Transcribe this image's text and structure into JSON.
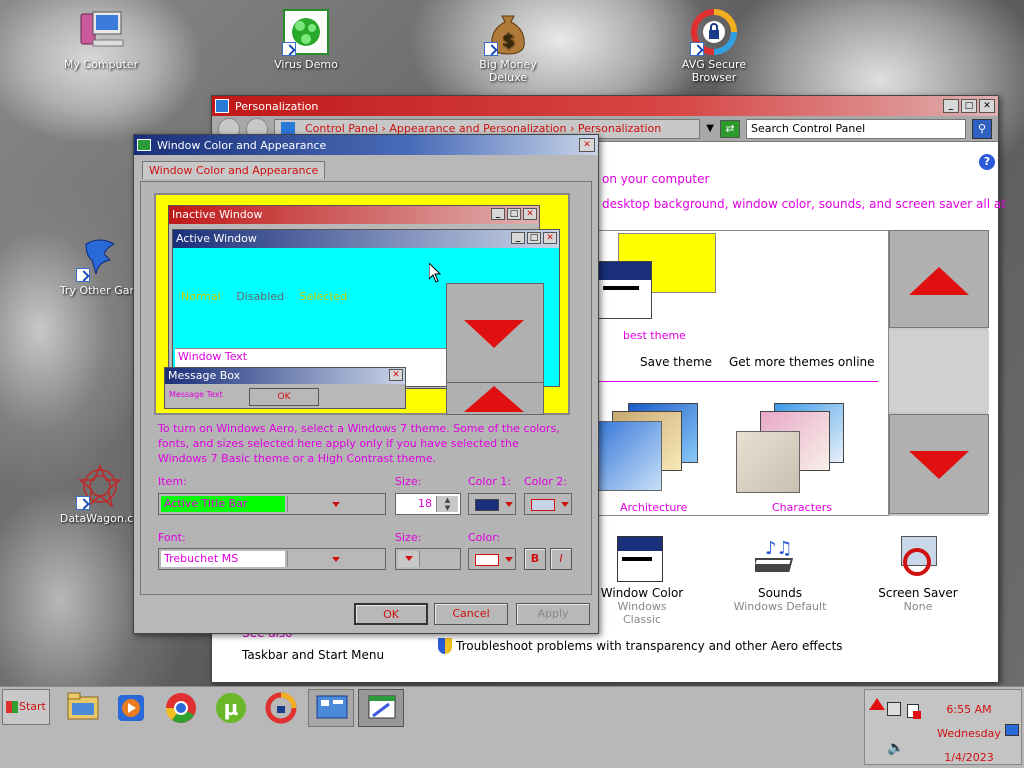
{
  "desktop": {
    "icons": [
      {
        "label": "My Computer"
      },
      {
        "label": "Virus Demo"
      },
      {
        "label": "Big Money Deluxe"
      },
      {
        "label": "AVG Secure Browser"
      },
      {
        "label": "Try Other Gam"
      },
      {
        "label": "DataWagon.co"
      }
    ]
  },
  "personalization": {
    "title": "Personalization",
    "breadcrumb": "Control Panel  ›  Appearance and Personalization  ›  Personalization",
    "search_placeholder": "Search Control Panel",
    "heading_line1": "on your computer",
    "heading_line2": "desktop background, window color, sounds, and screen saver all at",
    "theme_name": "best theme",
    "save_theme": "Save theme",
    "get_more_themes": "Get more themes online",
    "themes": [
      {
        "label": "Architecture"
      },
      {
        "label": "Characters"
      }
    ],
    "bottom_items": [
      {
        "label": "Window Color",
        "sub": "Windows Classic"
      },
      {
        "label": "Sounds",
        "sub": "Windows Default"
      },
      {
        "label": "Screen Saver",
        "sub": "None"
      }
    ],
    "see_also": "See also",
    "taskbar_link": "Taskbar and Start Menu",
    "troubleshoot_link": "Troubleshoot problems with transparency and other Aero effects"
  },
  "wca_dialog": {
    "title": "Window Color and Appearance",
    "tab_label": "Window Color and Appearance",
    "preview": {
      "inactive_title": "Inactive Window",
      "active_title": "Active Window",
      "normal": "Normal",
      "disabled": "Disabled",
      "selected": "Selected",
      "window_text": "Window Text",
      "msgbox_title": "Message Box",
      "msgbox_text": "Message Text",
      "msgbox_ok": "OK"
    },
    "info_text": "To turn on Windows Aero, select a Windows 7 theme.  Some of the colors, fonts, and sizes selected here apply only if you have selected the Windows 7 Basic theme or a High Contrast theme.",
    "item_label": "Item:",
    "item_value": "Active Title Bar",
    "size_label": "Size:",
    "size_value": "18",
    "color1_label": "Color 1:",
    "color2_label": "Color 2:",
    "font_label": "Font:",
    "font_value": "Trebuchet MS",
    "font_size_label": "Size:",
    "font_color_label": "Color:",
    "bold_label": "B",
    "italic_label": "I",
    "ok": "OK",
    "cancel": "Cancel",
    "apply": "Apply"
  },
  "taskbar": {
    "start_label": "Start",
    "time": "6:55 AM",
    "day": "Wednesday",
    "date": "1/4/2023"
  },
  "colors": {
    "active_title": "#1a2f7a",
    "inactive_title": "#c01818",
    "accent_red": "#e01010",
    "magenta_text": "#e000e0",
    "preview_bg": "#ffff00",
    "cyan": "#00ffff",
    "green": "#00ff00"
  }
}
